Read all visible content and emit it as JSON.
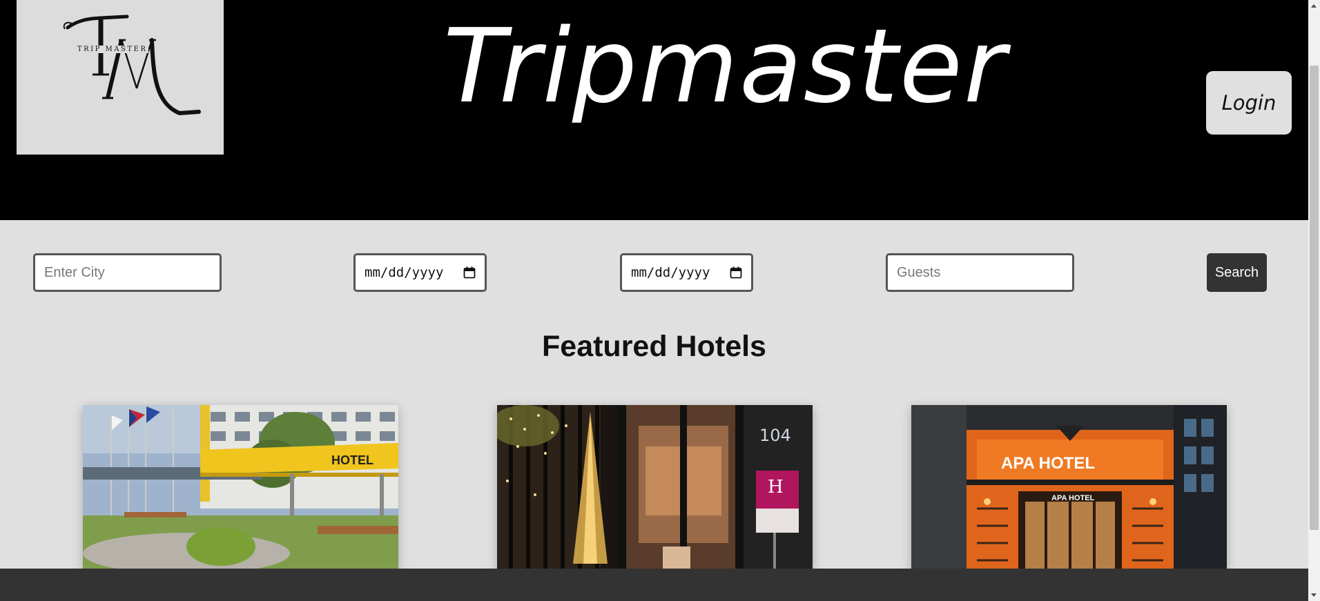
{
  "header": {
    "logo_monogram": "TM",
    "logo_wordmark": "TRIP MASTER",
    "site_title": "Tripmaster",
    "login_label": "Login"
  },
  "search": {
    "city_placeholder": "Enter City",
    "checkin_value": "mm/dd/yyyy",
    "checkout_value": "mm/dd/yyyy",
    "guests_placeholder": "Guests",
    "search_label": "Search"
  },
  "featured": {
    "title": "Featured Hotels",
    "hotels": [
      {
        "image_desc": "hotel-entrance-yellow-canopy",
        "sign": "HOTEL"
      },
      {
        "image_desc": "hotel-entrance-eiffel-lights",
        "sign": "104"
      },
      {
        "image_desc": "apa-hotel-facade",
        "sign": "APA HOTEL"
      }
    ]
  },
  "colors": {
    "header_bg": "#000000",
    "page_bg": "#e0e0e0",
    "button_dark": "#333333",
    "footer_bg": "#333333"
  },
  "icons": [
    "calendar-icon",
    "logo-icon"
  ]
}
